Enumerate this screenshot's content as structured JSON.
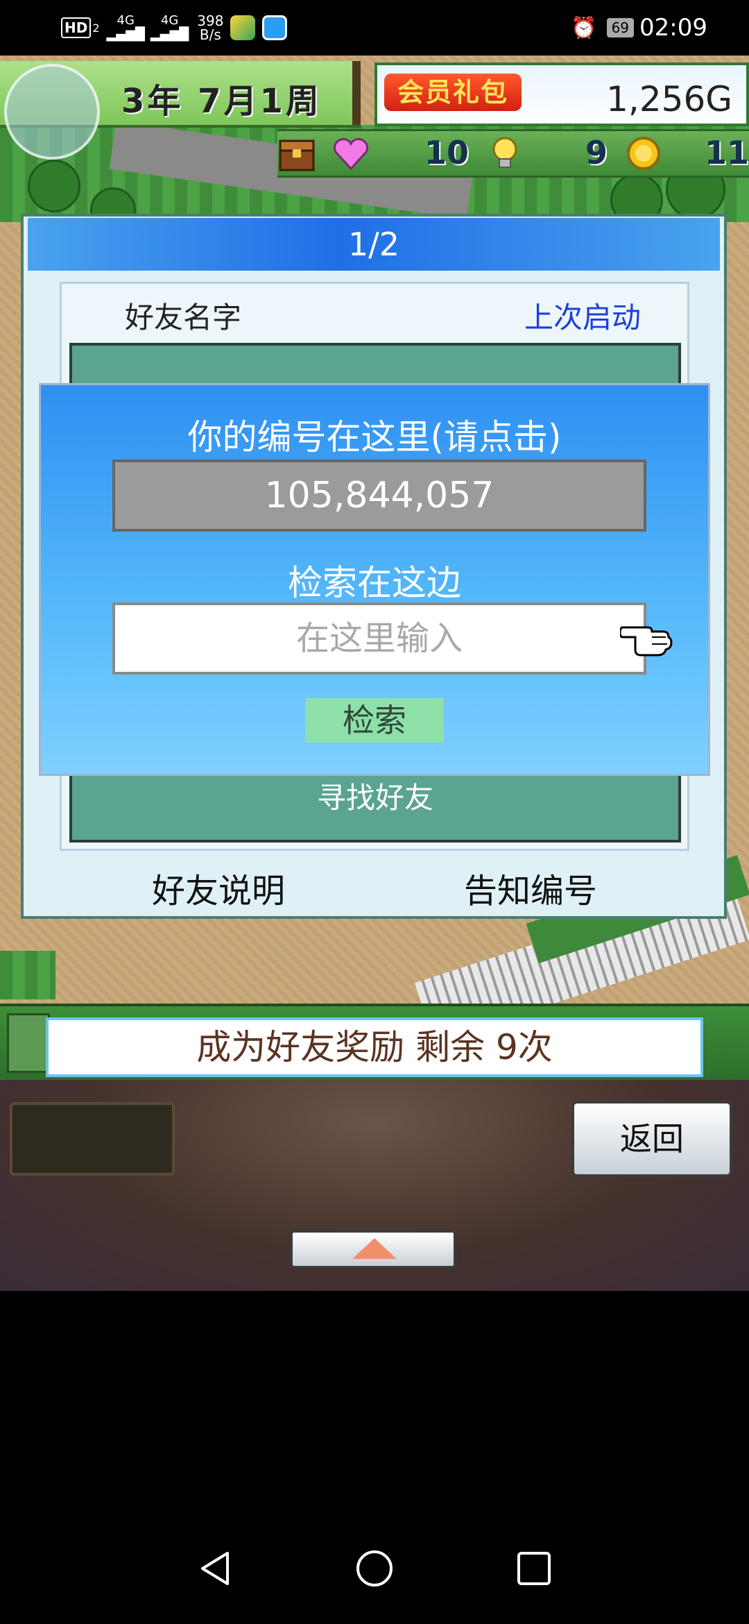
{
  "status_bar": {
    "hd_label": "HD",
    "hd_sub": "2",
    "net1": "4G",
    "net2": "4G",
    "speed_value": "398",
    "speed_unit": "B/s",
    "battery": "69",
    "time": "02:09",
    "icons": [
      "hd-icon",
      "signal-icon",
      "signal-icon",
      "game-app-icon",
      "browser-app-icon",
      "alarm-icon",
      "battery-icon"
    ]
  },
  "hud": {
    "date": "3年 7月1周",
    "vip_label": "会员礼包",
    "money": "1,256G",
    "stats": [
      {
        "icon": "treasure-chest-icon",
        "value": ""
      },
      {
        "icon": "heart-icon",
        "value": "10"
      },
      {
        "icon": "lightbulb-icon",
        "value": "9"
      },
      {
        "icon": "coin-icon",
        "value": "11"
      }
    ]
  },
  "friends_dialog": {
    "page_indicator": "1/2",
    "col_name": "好友名字",
    "col_last_launch": "上次启动",
    "find_friend": "寻找好友",
    "help_button": "好友说明",
    "tell_id_button": "告知编号"
  },
  "id_popup": {
    "title": "你的编号在这里(请点击)",
    "my_id": "105,844,057",
    "search_label": "检索在这边",
    "search_placeholder": "在这里输入",
    "search_button": "检索"
  },
  "bottom": {
    "bonus_text": "成为好友奖励 剩余 9次",
    "back_button": "返回"
  },
  "colors": {
    "popup_top": "#2f8ff2",
    "popup_bottom": "#7fd0ff",
    "list_bg": "#5aa491",
    "header_blue": "#1f6fe6",
    "vip_red": "#d41f12",
    "vip_text": "#ffe35a"
  }
}
